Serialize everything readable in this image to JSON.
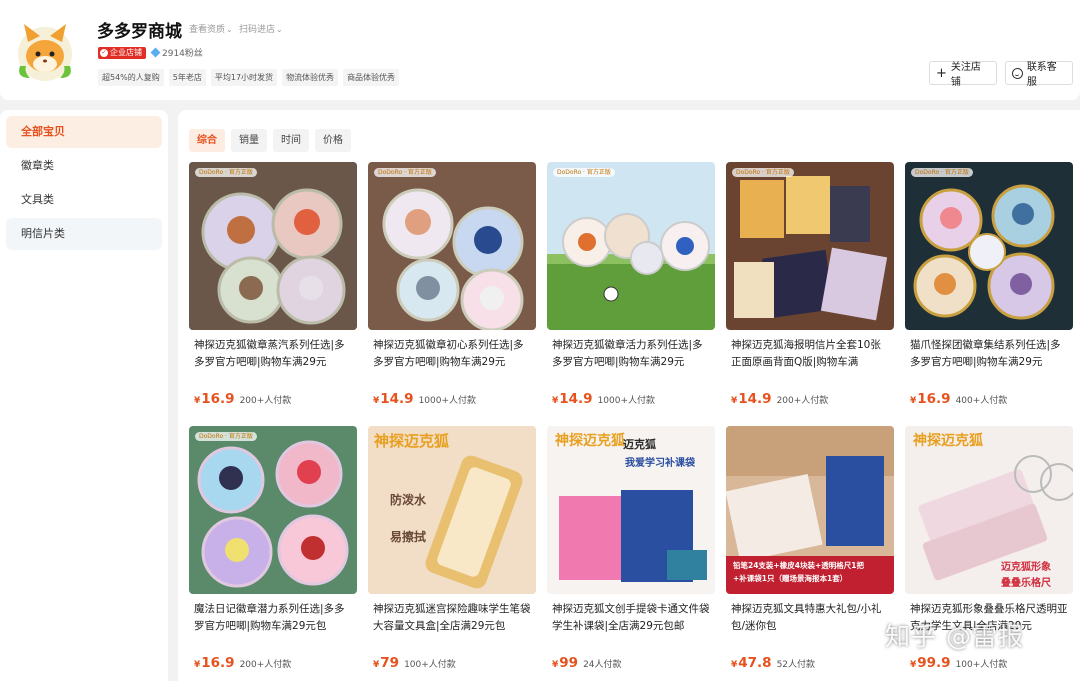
{
  "header": {
    "shop_name": "多多罗商城",
    "link_qualification": "查看资质",
    "link_scan": "扫码进店",
    "enterprise_badge": "企业店铺",
    "fans": "2914粉丝",
    "tags": [
      "超54%的人复购",
      "5年老店",
      "平均17小时发货",
      "物流体验优秀",
      "商品体验优秀"
    ],
    "follow_button": "关注店铺",
    "service_button": "联系客服"
  },
  "sidebar": {
    "items": [
      {
        "label": "全部宝贝",
        "active": true
      },
      {
        "label": "徽章类",
        "active": false
      },
      {
        "label": "文具类",
        "active": false
      },
      {
        "label": "明信片类",
        "active": false
      }
    ]
  },
  "sort_tabs": [
    {
      "label": "综合",
      "active": true
    },
    {
      "label": "销量",
      "active": false
    },
    {
      "label": "时间",
      "active": false
    },
    {
      "label": "价格",
      "active": false
    }
  ],
  "products": [
    {
      "title": "神探迈克狐徽章蒸汽系列任选|多多罗官方吧唧|购物车满29元",
      "currency": "¥",
      "price": "16.9",
      "sold": "200+人付款",
      "pill": "DoDoRo · 官方正版"
    },
    {
      "title": "神探迈克狐徽章初心系列任选|多多罗官方吧唧|购物车满29元",
      "currency": "¥",
      "price": "14.9",
      "sold": "1000+人付款",
      "pill": "DoDoRo · 官方正版"
    },
    {
      "title": "神探迈克狐徽章活力系列任选|多多罗官方吧唧|购物车满29元",
      "currency": "¥",
      "price": "14.9",
      "sold": "1000+人付款",
      "pill": "DoDoRo · 官方正版"
    },
    {
      "title": "神探迈克狐海报明信片全套10张正面原画背面Q版|购物车满",
      "currency": "¥",
      "price": "14.9",
      "sold": "200+人付款",
      "pill": "DoDoRo · 官方正版"
    },
    {
      "title": "猫爪怪探团徽章集结系列任选|多多罗官方吧唧|购物车满29元",
      "currency": "¥",
      "price": "16.9",
      "sold": "400+人付款",
      "pill": "DoDoRo · 官方正版"
    },
    {
      "title": "魔法日记徽章潜力系列任选|多多罗官方吧唧|购物车满29元包",
      "currency": "¥",
      "price": "16.9",
      "sold": "200+人付款",
      "pill": "DoDoRo · 官方正版"
    },
    {
      "title": "神探迈克狐迷宫探险趣味学生笔袋大容量文具盒|全店满29元包",
      "currency": "¥",
      "price": "79",
      "sold": "100+人付款",
      "overlay": [
        "神探迈克狐",
        "防泼水",
        "易擦拭"
      ]
    },
    {
      "title": "神探迈克狐文创手提袋卡通文件袋学生补课袋|全店满29元包邮",
      "currency": "¥",
      "price": "99",
      "sold": "24人付款",
      "overlay": [
        "神探迈克狐",
        "迈克狐",
        "我爱学习补课袋"
      ]
    },
    {
      "title": "神探迈克狐文具特惠大礼包/小礼包/迷你包",
      "currency": "¥",
      "price": "47.8",
      "sold": "52人付款",
      "overlay": [
        "铅笔24支装+橡皮4块装+透明格尺1把",
        "+补课袋1只（赠场景海报本1套）"
      ]
    },
    {
      "title": "神探迈克狐形象叠叠乐格尺透明亚克力学生文具|全店满29元",
      "currency": "¥",
      "price": "99.9",
      "sold": "100+人付款",
      "overlay": [
        "神探迈克狐",
        "迈克狐形象",
        "叠叠乐格尺"
      ]
    }
  ],
  "watermark": "知乎 @雷报",
  "colors": {
    "accent": "#e5521e",
    "badge_red": "#e02e24"
  }
}
